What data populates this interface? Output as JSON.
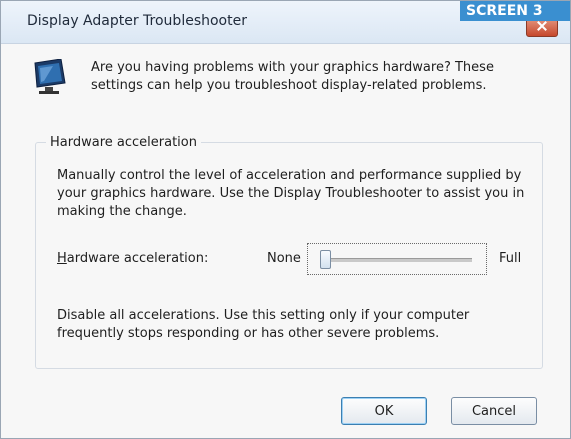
{
  "window": {
    "title": "Display Adapter Troubleshooter",
    "watermark": "SCREEN 3"
  },
  "intro": {
    "icon": "monitor-icon",
    "text": "Are you having problems with your graphics hardware? These settings can help you troubleshoot display-related problems."
  },
  "group": {
    "title": "Hardware acceleration",
    "description": "Manually control the level of acceleration and performance supplied by your graphics hardware. Use the Display Troubleshooter to assist you in making the change.",
    "slider_label_prefix": "H",
    "slider_label_rest": "ardware acceleration:",
    "slider_min_label": "None",
    "slider_max_label": "Full",
    "slider_level": 0,
    "warning": "Disable all accelerations. Use this setting only if your computer frequently stops responding or has other severe problems."
  },
  "buttons": {
    "ok": "OK",
    "cancel": "Cancel"
  },
  "colors": {
    "title_bar": "#dbe7f4",
    "accent": "#3c7fb1",
    "close_button": "#c6482c"
  }
}
